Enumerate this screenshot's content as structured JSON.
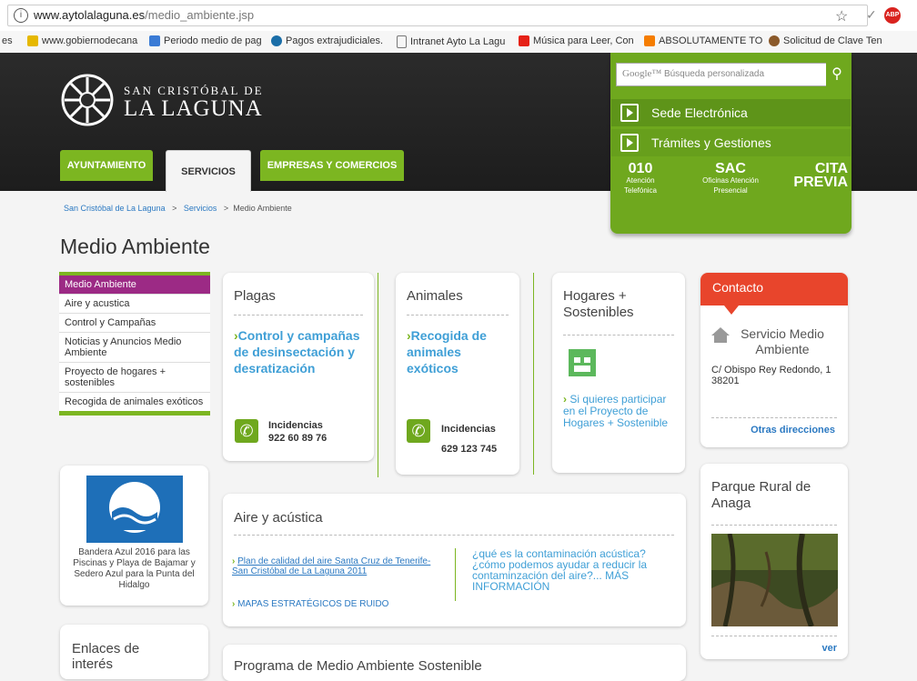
{
  "browser": {
    "url_domain": "www.aytolalaguna.es",
    "url_path": "/medio_ambiente.jsp",
    "abp_label": "ABP",
    "bookmarks": [
      {
        "label": "es",
        "color": ""
      },
      {
        "label": "www.gobiernodecana",
        "color": "#e6b800"
      },
      {
        "label": "Periodo medio de pag",
        "color": "#3a7bd5"
      },
      {
        "label": "Pagos extrajudiciales.",
        "color": "#1a6ea8"
      },
      {
        "label": "Intranet Ayto La Lagu",
        "color": ""
      },
      {
        "label": "Música para Leer, Con",
        "color": "#e62117"
      },
      {
        "label": "ABSOLUTAMENTE TO",
        "color": "#f57d00"
      },
      {
        "label": "Solicitud de Clave Ten",
        "color": "#8b5a2b"
      }
    ]
  },
  "header": {
    "logo_top": "SAN CRISTÓBAL DE",
    "logo_bottom": "LA LAGUNA",
    "nav": [
      "AYUNTAMIENTO",
      "SERVICIOS",
      "EMPRESAS Y COMERCIOS"
    ],
    "search_placeholder": "Búsqueda personalizada",
    "search_brand": "Google™",
    "green_buttons": [
      "Sede Electrónica",
      "Trámites y Gestiones"
    ],
    "quick": [
      {
        "big": "010",
        "small": "Atención Telefónica"
      },
      {
        "big": "SAC",
        "small": "Oficinas Atención Presencial"
      },
      {
        "big": "CITA PREVIA",
        "small": ""
      }
    ]
  },
  "breadcrumb": [
    "San Cristóbal de La Laguna",
    ">",
    "Servicios",
    ">",
    "Medio Ambiente"
  ],
  "page_title": "Medio Ambiente",
  "sidebar": {
    "items": [
      "Medio Ambiente",
      "Aire y acustica",
      "Control y Campañas",
      "Noticias y Anuncios Medio Ambiente",
      "Proyecto de hogares + sostenibles",
      "Recogida de animales exóticos"
    ],
    "banner_caption": "Bandera Azul 2016 para las Piscinas y Playa de Bajamar y Sedero Azul para la Punta del Hidalgo",
    "links_title": "Enlaces de interés"
  },
  "cards": {
    "plagas": {
      "title": "Plagas",
      "link": "Control y campañas de desinsectación y desratización",
      "inc_label": "Incidencias",
      "phone": "922 60 89 76"
    },
    "animales": {
      "title": "Animales",
      "link": "Recogida de animales exóticos",
      "inc_label": "Incidencias",
      "phone": "629 123 745"
    },
    "hogares": {
      "title": "Hogares + Sostenibles",
      "link": "Si quieres participar en el Proyecto de Hogares + Sostenible"
    },
    "contacto": {
      "title": "Contacto",
      "service": "Servicio Medio Ambiente",
      "address": "C/ Obispo Rey Redondo, 1 38201",
      "other": "Otras direcciones"
    },
    "aire": {
      "title": "Aire y acústica",
      "link1": "Plan de calidad del aire Santa Cruz de Tenerife-San Cristóbal de La Laguna 2011",
      "link2": "MAPAS ESTRATÉGICOS DE RUIDO",
      "right": "¿qué es la contaminación acústica? ¿cómo podemos ayudar a reducir la contaminzación del aire?... MÁS INFORMACIÓN"
    },
    "anaga": {
      "title": "Parque Rural de Anaga",
      "ver": "ver"
    },
    "bottom_title": "Programa de Medio Ambiente Sostenible"
  }
}
